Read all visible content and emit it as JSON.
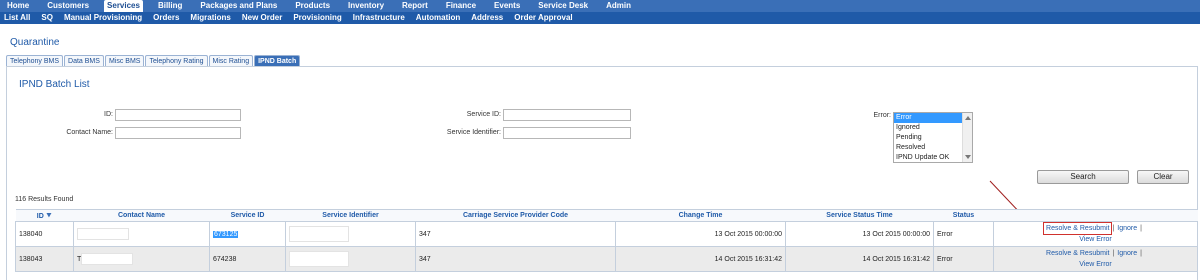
{
  "top_nav": [
    "Home",
    "Customers",
    "Services",
    "Billing",
    "Packages and Plans",
    "Products",
    "Inventory",
    "Report",
    "Finance",
    "Events",
    "Service Desk",
    "Admin"
  ],
  "top_nav_active": "Services",
  "sub_nav": [
    "List All",
    "SQ",
    "Manual Provisioning",
    "Orders",
    "Migrations",
    "New Order",
    "Provisioning",
    "Infrastructure",
    "Automation",
    "Address",
    "Order Approval"
  ],
  "page_title": "Quarantine",
  "tabs": [
    "Telephony BMS",
    "Data BMS",
    "Misc BMS",
    "Telephony Rating",
    "Misc Rating",
    "IPND Batch"
  ],
  "active_tab": "IPND Batch",
  "panel": {
    "title": "IPND Batch List",
    "filters": {
      "id_label": "ID:",
      "contact_name_label": "Contact Name:",
      "service_id_label": "Service ID:",
      "service_identifier_label": "Service Identifier:",
      "error_label": "Error:",
      "error_options": [
        "Error",
        "Ignored",
        "Pending",
        "Resolved",
        "IPND Update OK"
      ],
      "error_selected": "Error"
    },
    "search_button": "Search",
    "clear_button": "Clear",
    "results_text": "116 Results Found"
  },
  "table": {
    "headers": [
      "ID",
      "Contact Name",
      "Service ID",
      "Service Identifier",
      "Carriage Service Provider Code",
      "Change Time",
      "Service Status Time",
      "Status",
      ""
    ],
    "rows": [
      {
        "id": "138040",
        "contact": "",
        "service_id": "673125",
        "service_identifier": "",
        "csp_code": "347",
        "change_time": "13 Oct 2015 00:00:00",
        "status_time": "13 Oct 2015 00:00:00",
        "status": "Error"
      },
      {
        "id": "138043",
        "contact": "T",
        "service_id": "674238",
        "service_identifier": "",
        "csp_code": "347",
        "change_time": "14 Oct 2015 16:31:42",
        "status_time": "14 Oct 2015 16:31:42",
        "status": "Error"
      }
    ],
    "actions": {
      "resolve": "Resolve & Resubmit",
      "sep": "|",
      "ignore": "Ignore",
      "view_error": "View Error"
    }
  },
  "colors": {
    "nav_blue": "#3a6fb7",
    "sub_nav_blue": "#1f5aa8",
    "highlight_red": "#d0312d",
    "arrow": "#a01f1f"
  }
}
